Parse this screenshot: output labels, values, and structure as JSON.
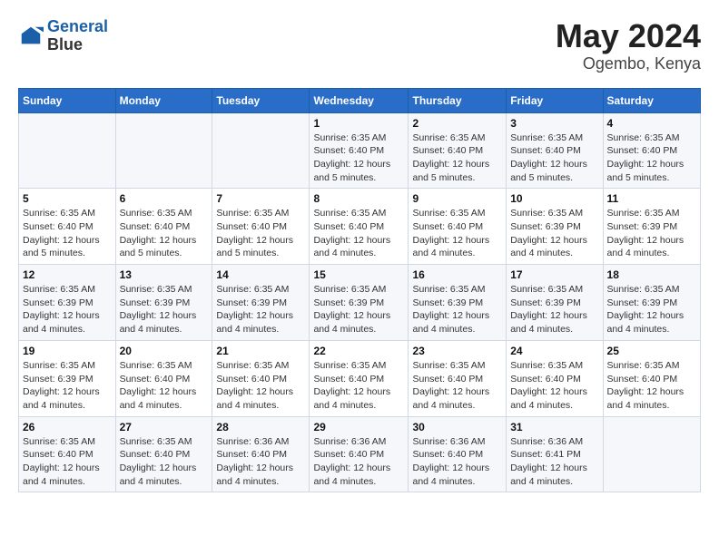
{
  "header": {
    "logo_line1": "General",
    "logo_line2": "Blue",
    "month": "May 2024",
    "location": "Ogembo, Kenya"
  },
  "days_of_week": [
    "Sunday",
    "Monday",
    "Tuesday",
    "Wednesday",
    "Thursday",
    "Friday",
    "Saturday"
  ],
  "weeks": [
    [
      {
        "day": "",
        "info": ""
      },
      {
        "day": "",
        "info": ""
      },
      {
        "day": "",
        "info": ""
      },
      {
        "day": "1",
        "info": "Sunrise: 6:35 AM\nSunset: 6:40 PM\nDaylight: 12 hours and 5 minutes."
      },
      {
        "day": "2",
        "info": "Sunrise: 6:35 AM\nSunset: 6:40 PM\nDaylight: 12 hours and 5 minutes."
      },
      {
        "day": "3",
        "info": "Sunrise: 6:35 AM\nSunset: 6:40 PM\nDaylight: 12 hours and 5 minutes."
      },
      {
        "day": "4",
        "info": "Sunrise: 6:35 AM\nSunset: 6:40 PM\nDaylight: 12 hours and 5 minutes."
      }
    ],
    [
      {
        "day": "5",
        "info": "Sunrise: 6:35 AM\nSunset: 6:40 PM\nDaylight: 12 hours and 5 minutes."
      },
      {
        "day": "6",
        "info": "Sunrise: 6:35 AM\nSunset: 6:40 PM\nDaylight: 12 hours and 5 minutes."
      },
      {
        "day": "7",
        "info": "Sunrise: 6:35 AM\nSunset: 6:40 PM\nDaylight: 12 hours and 5 minutes."
      },
      {
        "day": "8",
        "info": "Sunrise: 6:35 AM\nSunset: 6:40 PM\nDaylight: 12 hours and 4 minutes."
      },
      {
        "day": "9",
        "info": "Sunrise: 6:35 AM\nSunset: 6:40 PM\nDaylight: 12 hours and 4 minutes."
      },
      {
        "day": "10",
        "info": "Sunrise: 6:35 AM\nSunset: 6:39 PM\nDaylight: 12 hours and 4 minutes."
      },
      {
        "day": "11",
        "info": "Sunrise: 6:35 AM\nSunset: 6:39 PM\nDaylight: 12 hours and 4 minutes."
      }
    ],
    [
      {
        "day": "12",
        "info": "Sunrise: 6:35 AM\nSunset: 6:39 PM\nDaylight: 12 hours and 4 minutes."
      },
      {
        "day": "13",
        "info": "Sunrise: 6:35 AM\nSunset: 6:39 PM\nDaylight: 12 hours and 4 minutes."
      },
      {
        "day": "14",
        "info": "Sunrise: 6:35 AM\nSunset: 6:39 PM\nDaylight: 12 hours and 4 minutes."
      },
      {
        "day": "15",
        "info": "Sunrise: 6:35 AM\nSunset: 6:39 PM\nDaylight: 12 hours and 4 minutes."
      },
      {
        "day": "16",
        "info": "Sunrise: 6:35 AM\nSunset: 6:39 PM\nDaylight: 12 hours and 4 minutes."
      },
      {
        "day": "17",
        "info": "Sunrise: 6:35 AM\nSunset: 6:39 PM\nDaylight: 12 hours and 4 minutes."
      },
      {
        "day": "18",
        "info": "Sunrise: 6:35 AM\nSunset: 6:39 PM\nDaylight: 12 hours and 4 minutes."
      }
    ],
    [
      {
        "day": "19",
        "info": "Sunrise: 6:35 AM\nSunset: 6:39 PM\nDaylight: 12 hours and 4 minutes."
      },
      {
        "day": "20",
        "info": "Sunrise: 6:35 AM\nSunset: 6:40 PM\nDaylight: 12 hours and 4 minutes."
      },
      {
        "day": "21",
        "info": "Sunrise: 6:35 AM\nSunset: 6:40 PM\nDaylight: 12 hours and 4 minutes."
      },
      {
        "day": "22",
        "info": "Sunrise: 6:35 AM\nSunset: 6:40 PM\nDaylight: 12 hours and 4 minutes."
      },
      {
        "day": "23",
        "info": "Sunrise: 6:35 AM\nSunset: 6:40 PM\nDaylight: 12 hours and 4 minutes."
      },
      {
        "day": "24",
        "info": "Sunrise: 6:35 AM\nSunset: 6:40 PM\nDaylight: 12 hours and 4 minutes."
      },
      {
        "day": "25",
        "info": "Sunrise: 6:35 AM\nSunset: 6:40 PM\nDaylight: 12 hours and 4 minutes."
      }
    ],
    [
      {
        "day": "26",
        "info": "Sunrise: 6:35 AM\nSunset: 6:40 PM\nDaylight: 12 hours and 4 minutes."
      },
      {
        "day": "27",
        "info": "Sunrise: 6:35 AM\nSunset: 6:40 PM\nDaylight: 12 hours and 4 minutes."
      },
      {
        "day": "28",
        "info": "Sunrise: 6:36 AM\nSunset: 6:40 PM\nDaylight: 12 hours and 4 minutes."
      },
      {
        "day": "29",
        "info": "Sunrise: 6:36 AM\nSunset: 6:40 PM\nDaylight: 12 hours and 4 minutes."
      },
      {
        "day": "30",
        "info": "Sunrise: 6:36 AM\nSunset: 6:40 PM\nDaylight: 12 hours and 4 minutes."
      },
      {
        "day": "31",
        "info": "Sunrise: 6:36 AM\nSunset: 6:41 PM\nDaylight: 12 hours and 4 minutes."
      },
      {
        "day": "",
        "info": ""
      }
    ]
  ]
}
